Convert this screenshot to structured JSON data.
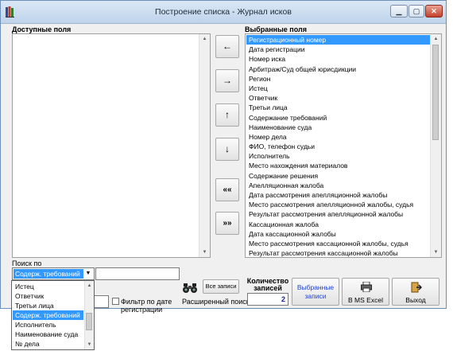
{
  "window": {
    "title": "Построение списка - Журнал исков"
  },
  "available": {
    "label": "Доступные поля",
    "items": []
  },
  "selected": {
    "label": "Выбранные поля",
    "items": [
      "Регистрационный номер",
      "Дата регистрации",
      "Номер иска",
      "Арбитраж/Суд общей юрисдикции",
      "Регион",
      "Истец",
      "Ответчик",
      "Третьи лица",
      "Содержание требований",
      "Наименование суда",
      "Номер дела",
      "ФИО, телефон судьи",
      "Исполнитель",
      "Место нахождения материалов",
      "Содержание решения",
      "Апелляционная жалоба",
      "Дата рассмотрения апелляционной жалобы",
      "Место рассмотрения апелляционной жалобы, судья",
      "Результат рассмотрения апелляционной жалобы",
      "Кассационная жалоба",
      "Дата кассационной жалобы",
      "Место рассмотрения кассационной жалобы, судья",
      "Результат рассмотрения кассационной жалобы"
    ],
    "selected_index": 0
  },
  "move": {
    "left": "←",
    "right": "→",
    "up": "↑",
    "down": "↓",
    "all_left": "««",
    "all_right": "»»"
  },
  "search": {
    "label": "Поиск по",
    "field_value": "Содерж. требований",
    "dropdown": [
      "Истец",
      "Ответчик",
      "Третьи лица",
      "Содерж. требований",
      "Исполнитель",
      "Наименование суда",
      "№ дела"
    ],
    "dropdown_selected_index": 3
  },
  "extended_search": {
    "label": "Расширенный поиск"
  },
  "all_records": {
    "label": "Все записи"
  },
  "date_filter": {
    "label": "Фильтр по дате регистрации",
    "checked": false
  },
  "count": {
    "label": "Количество записей",
    "value": "2"
  },
  "actions": {
    "selected_records": "Выбранные записи",
    "ms_excel": "В MS Excel",
    "exit": "Выход"
  }
}
